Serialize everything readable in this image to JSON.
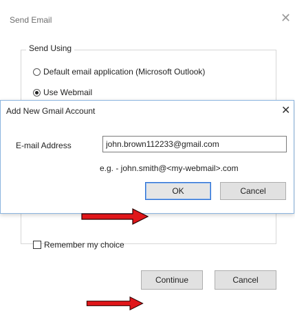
{
  "send_email": {
    "title": "Send Email",
    "close_glyph": "✕",
    "group_label": "Send Using",
    "options": [
      {
        "label": "Default email application (Microsoft Outlook)",
        "checked": false
      },
      {
        "label": "Use Webmail",
        "checked": true
      }
    ],
    "remember_label": "Remember my choice",
    "remember_checked": false,
    "continue_label": "Continue",
    "cancel_label": "Cancel"
  },
  "gmail_dialog": {
    "title": "Add New Gmail Account",
    "close_glyph": "✕",
    "email_label": "E-mail Address",
    "email_value": "john.brown112233@gmail.com",
    "example_text": "e.g. - john.smith@<my-webmail>.com",
    "ok_label": "OK",
    "cancel_label": "Cancel"
  },
  "colors": {
    "arrow": "#e0161a",
    "arrow_outline": "#2a0000",
    "dialog_border": "#8ab4df",
    "ok_focus": "#2f6fcf"
  },
  "icons": [
    "close-icon",
    "radio-button",
    "checkbox",
    "red-arrow-icon"
  ]
}
